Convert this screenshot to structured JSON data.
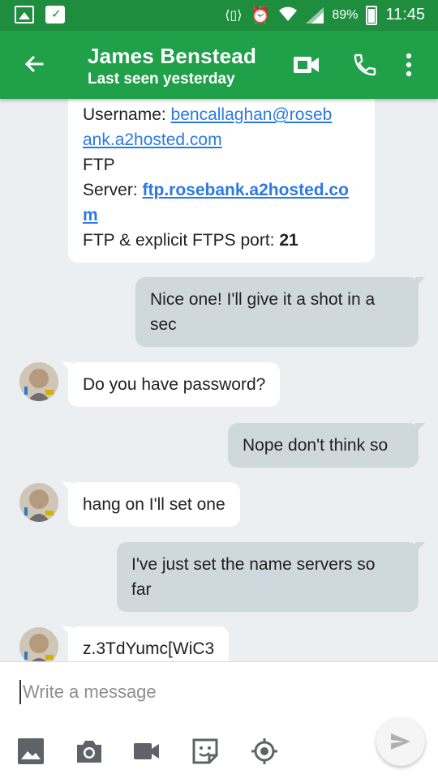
{
  "status_bar": {
    "battery": "89%",
    "time": "11:45"
  },
  "header": {
    "contact_name": "James Benstead",
    "last_seen": "Last seen yesterday"
  },
  "messages": [
    {
      "direction": "incoming",
      "username_label": "Username: ",
      "username_line1": "bencallaghan@roseb",
      "username_line2": "ank.a2hosted.com",
      "ftp_label": "FTP",
      "server_label": "Server: ",
      "server_line1": "ftp.rosebank.a2hosted.co",
      "server_line2": "m",
      "port_label": "FTP & explicit FTPS port: ",
      "port_value": "21"
    },
    {
      "direction": "outgoing",
      "line1": "Nice one! I'll give it a shot in a",
      "line2": "sec"
    },
    {
      "direction": "incoming",
      "text": "Do you have password?"
    },
    {
      "direction": "outgoing",
      "text": "Nope don't think so"
    },
    {
      "direction": "incoming",
      "text": "hang on I'll set one"
    },
    {
      "direction": "outgoing",
      "line1": "I've just set the name servers so",
      "line2": "far"
    },
    {
      "direction": "incoming",
      "text": "z.3TdYumc[WiC3"
    }
  ],
  "composer": {
    "placeholder": "Write a message"
  },
  "colors": {
    "status_bar": "#1e8e3e",
    "app_bar": "#20a049",
    "incoming_bubble": "#ffffff",
    "outgoing_bubble": "#cfd8dc",
    "link": "#2a7ae2",
    "background": "#eceff1"
  },
  "icons": [
    "gallery-icon",
    "shopping-bag-icon",
    "vibrate-icon",
    "mute-icon",
    "alarm-icon",
    "wifi-icon",
    "signal-icon",
    "battery-icon",
    "back-arrow-icon",
    "video-call-icon",
    "phone-icon",
    "more-vert-icon",
    "image-icon",
    "camera-icon",
    "video-icon",
    "sticker-icon",
    "location-icon",
    "send-icon"
  ]
}
